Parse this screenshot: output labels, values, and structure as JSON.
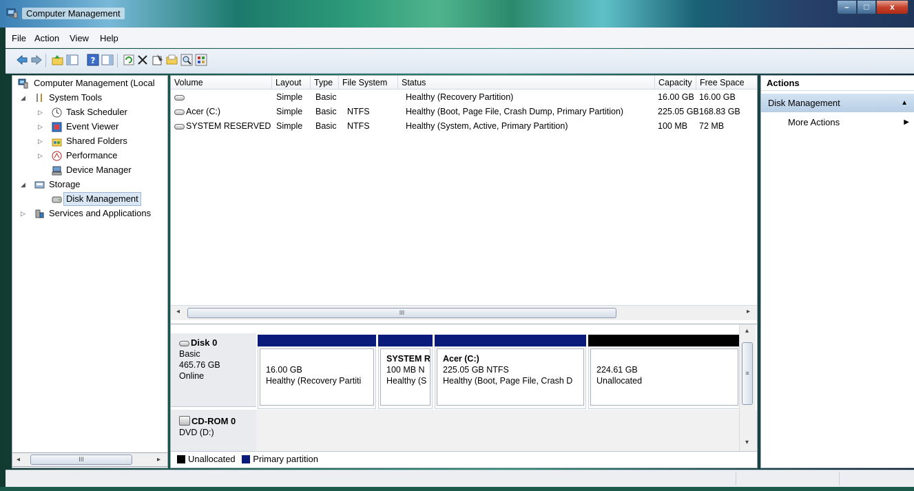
{
  "window": {
    "title": "Computer Management",
    "controls": {
      "minimize": "–",
      "maximize": "□",
      "close": "x"
    }
  },
  "menu": [
    "File",
    "Action",
    "View",
    "Help"
  ],
  "toolbar": {
    "icons": [
      "back-icon",
      "forward-icon",
      "up-folder-icon",
      "show-hide-tree-icon",
      "help-icon",
      "show-hide-action-pane-icon",
      "refresh-icon",
      "delete-icon",
      "properties-icon",
      "open-icon",
      "search-icon",
      "settings-icon"
    ]
  },
  "tree": {
    "items": [
      {
        "label": "Computer Management (Local",
        "icon": "computer-management-icon",
        "arrow": ""
      },
      {
        "label": "System Tools",
        "icon": "tools-icon",
        "arrow": "◢"
      },
      {
        "label": "Task Scheduler",
        "icon": "clock-icon",
        "arrow": "▷"
      },
      {
        "label": "Event Viewer",
        "icon": "event-viewer-icon",
        "arrow": "▷"
      },
      {
        "label": "Shared Folders",
        "icon": "shared-folder-icon",
        "arrow": "▷"
      },
      {
        "label": "Performance",
        "icon": "performance-icon",
        "arrow": "▷"
      },
      {
        "label": "Device Manager",
        "icon": "device-manager-icon",
        "arrow": ""
      },
      {
        "label": "Storage",
        "icon": "storage-icon",
        "arrow": "◢"
      },
      {
        "label": "Disk Management",
        "icon": "disk-management-icon",
        "arrow": ""
      },
      {
        "label": "Services and Applications",
        "icon": "services-icon",
        "arrow": "▷"
      }
    ],
    "scroll_thumb": "III"
  },
  "volumes": {
    "columns": [
      "Volume",
      "Layout",
      "Type",
      "File System",
      "Status",
      "Capacity",
      "Free Space"
    ],
    "rows": [
      {
        "volume": "",
        "layout": "Simple",
        "type": "Basic",
        "fs": "",
        "status": "Healthy (Recovery Partition)",
        "capacity": "16.00 GB",
        "free": "16.00 GB"
      },
      {
        "volume": "Acer (C:)",
        "layout": "Simple",
        "type": "Basic",
        "fs": "NTFS",
        "status": "Healthy (Boot, Page File, Crash Dump, Primary Partition)",
        "capacity": "225.05 GB",
        "free": "168.83 GB"
      },
      {
        "volume": "SYSTEM RESERVED",
        "layout": "Simple",
        "type": "Basic",
        "fs": "NTFS",
        "status": "Healthy (System, Active, Primary Partition)",
        "capacity": "100 MB",
        "free": "72 MB"
      }
    ],
    "scroll_thumb": "III"
  },
  "disks": {
    "disk0": {
      "name": "Disk 0",
      "type": "Basic",
      "size": "465.76 GB",
      "state": "Online",
      "partitions": [
        {
          "title": "",
          "line1": "16.00 GB",
          "line2": "Healthy (Recovery Partiti"
        },
        {
          "title": "SYSTEM R",
          "line1": "100 MB N",
          "line2": "Healthy (S"
        },
        {
          "title": "Acer  (C:)",
          "line1": "225.05 GB NTFS",
          "line2": "Healthy (Boot, Page File, Crash D"
        },
        {
          "title": "",
          "line1": "224.61 GB",
          "line2": "Unallocated"
        }
      ]
    },
    "cdrom0": {
      "name": "CD-ROM 0",
      "drive": "DVD (D:)"
    },
    "scroll_thumb": "≡"
  },
  "legend": [
    {
      "label": "Unallocated",
      "color": "#000000"
    },
    {
      "label": "Primary partition",
      "color": "#0a1a7a"
    }
  ],
  "actions": {
    "header": "Actions",
    "section": "Disk Management",
    "items": [
      "More Actions"
    ]
  },
  "colors": {
    "primary_partition": "#0a1a7a",
    "unallocated": "#000000",
    "selection": "#d9e6f4"
  }
}
